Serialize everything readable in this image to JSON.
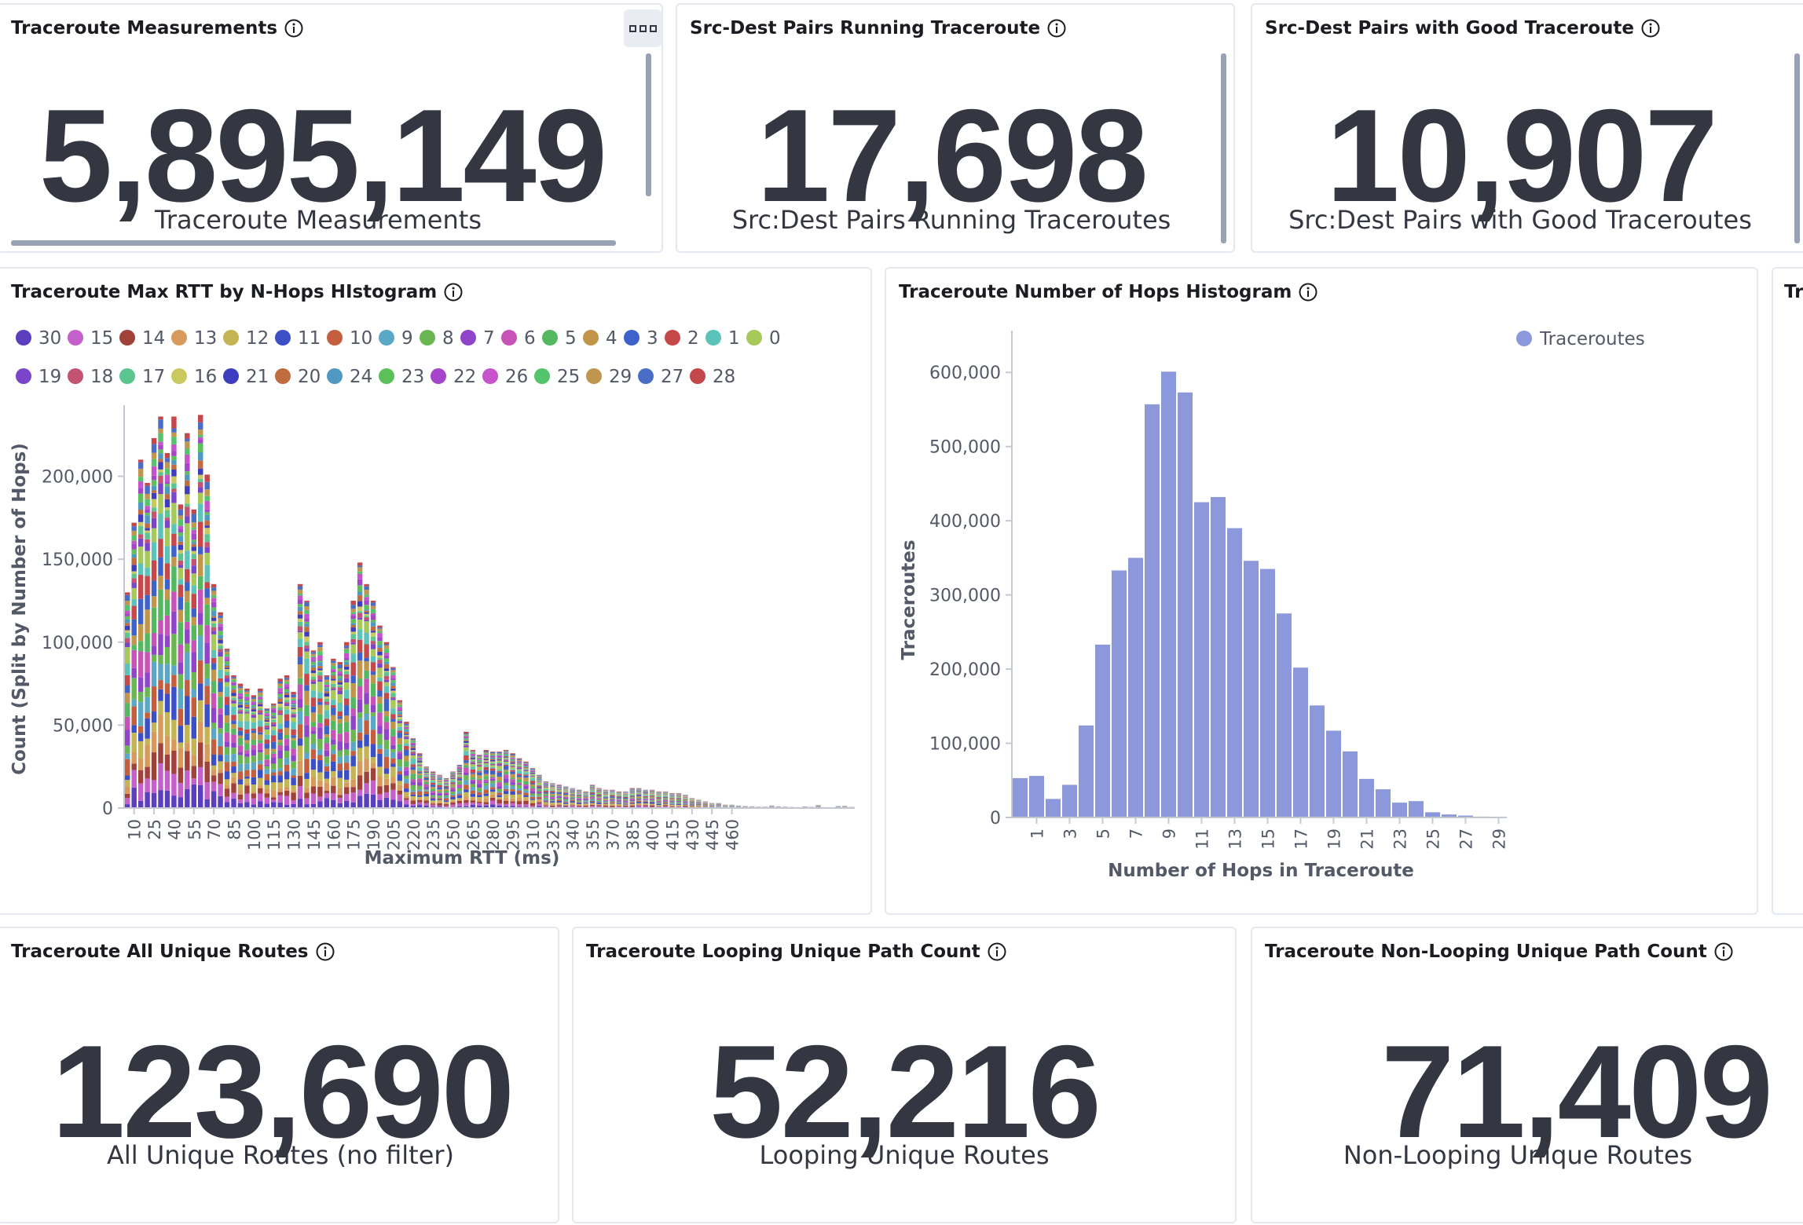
{
  "metric_panels": {
    "traceroute_measurements": {
      "title": "Traceroute Measurements",
      "value": "5,895,149",
      "label": "Traceroute Measurements"
    },
    "pairs_running": {
      "title": "Src-Dest Pairs Running Traceroute",
      "value": "17,698",
      "label": "Src:Dest Pairs Running Traceroutes"
    },
    "pairs_good": {
      "title": "Src-Dest Pairs with Good Traceroute",
      "value": "10,907",
      "label": "Src:Dest Pairs with Good Traceroutes"
    },
    "all_unique": {
      "title": "Traceroute All Unique Routes",
      "value": "123,690",
      "label": "All Unique Routes (no filter)"
    },
    "looping_unique": {
      "title": "Traceroute Looping Unique Path Count",
      "value": "52,216",
      "label": "Looping Unique Routes"
    },
    "nonlooping_unique": {
      "title": "Traceroute Non-Looping Unique Path Count",
      "value": "71,409",
      "label": "Non-Looping Unique Routes"
    }
  },
  "partial_panel": {
    "title": "Tr"
  },
  "icons": {
    "info": "info-circle-icon",
    "menu": "panel-options-icon",
    "legend_dot": "legend-dot-icon"
  },
  "chart_data": [
    {
      "type": "bar",
      "stacked": true,
      "title": "Traceroute Max RTT by N-Hops HIstogram",
      "xlabel": "Maximum RTT (ms)",
      "ylabel": "Count (Split by Number of Hops)",
      "ylim": [
        0,
        240000
      ],
      "yticks": [
        0,
        50000,
        100000,
        150000,
        200000
      ],
      "ytick_labels": [
        "0",
        "50,000",
        "100,000",
        "150,000",
        "200,000"
      ],
      "xtick_labels": [
        "10",
        "25",
        "40",
        "55",
        "70",
        "85",
        "100",
        "115",
        "130",
        "145",
        "160",
        "175",
        "190",
        "205",
        "220",
        "235",
        "250",
        "265",
        "280",
        "295",
        "310",
        "325",
        "340",
        "355",
        "370",
        "385",
        "400",
        "415",
        "430",
        "445",
        "460"
      ],
      "bin_width_ms": 5,
      "x_start_ms": 5,
      "legend_position": "top-left",
      "legend": [
        {
          "name": "30",
          "color": "#5c3fbf"
        },
        {
          "name": "15",
          "color": "#c460c9"
        },
        {
          "name": "14",
          "color": "#a0413a"
        },
        {
          "name": "13",
          "color": "#d69b5c"
        },
        {
          "name": "12",
          "color": "#c4b454"
        },
        {
          "name": "11",
          "color": "#3b4fc6"
        },
        {
          "name": "10",
          "color": "#c45e3e"
        },
        {
          "name": "9",
          "color": "#5ba7c6"
        },
        {
          "name": "8",
          "color": "#6ab752"
        },
        {
          "name": "7",
          "color": "#8f44c9"
        },
        {
          "name": "6",
          "color": "#c752b8"
        },
        {
          "name": "5",
          "color": "#54b861"
        },
        {
          "name": "4",
          "color": "#c2964a"
        },
        {
          "name": "3",
          "color": "#3d62c9"
        },
        {
          "name": "2",
          "color": "#c64848"
        },
        {
          "name": "1",
          "color": "#5bc3b9"
        },
        {
          "name": "0",
          "color": "#a6c95a"
        },
        {
          "name": "19",
          "color": "#7b45c9"
        },
        {
          "name": "18",
          "color": "#c45372"
        },
        {
          "name": "17",
          "color": "#5bc58f"
        },
        {
          "name": "16",
          "color": "#c9c95f"
        },
        {
          "name": "21",
          "color": "#3c3dbf"
        },
        {
          "name": "20",
          "color": "#c06c3e"
        },
        {
          "name": "24",
          "color": "#4f98c2"
        },
        {
          "name": "23",
          "color": "#5cc05a"
        },
        {
          "name": "22",
          "color": "#a645c9"
        },
        {
          "name": "26",
          "color": "#c653c9"
        },
        {
          "name": "25",
          "color": "#54c46c"
        },
        {
          "name": "29",
          "color": "#c0964e"
        },
        {
          "name": "27",
          "color": "#4a6ec6"
        },
        {
          "name": "28",
          "color": "#c4474c"
        }
      ],
      "totals": [
        130000,
        172000,
        210000,
        196000,
        223000,
        236000,
        214000,
        236000,
        183000,
        226000,
        180000,
        237000,
        201000,
        135000,
        118000,
        96000,
        80000,
        75000,
        72000,
        68000,
        72000,
        60000,
        63000,
        78000,
        80000,
        70000,
        135000,
        125000,
        95000,
        100000,
        80000,
        90000,
        88000,
        100000,
        125000,
        148000,
        135000,
        125000,
        110000,
        100000,
        85000,
        65000,
        52000,
        42000,
        33000,
        25000,
        22000,
        20000,
        18000,
        22000,
        26000,
        46000,
        35000,
        32000,
        35000,
        34000,
        34000,
        35000,
        33000,
        30000,
        28000,
        24000,
        20000,
        16000,
        15000,
        14000,
        13000,
        12000,
        11000,
        10000,
        14000,
        12000,
        11000,
        11000,
        10000,
        10000,
        12000,
        12000,
        11000,
        11000,
        10000,
        10000,
        9000,
        9000,
        8000,
        6000,
        5000,
        4000,
        3000,
        3000,
        2000,
        2000,
        1500,
        1200,
        1000,
        800,
        800,
        1500,
        1000,
        800,
        600,
        500,
        900,
        700,
        1800,
        500,
        400,
        1200,
        1300,
        700
      ]
    },
    {
      "type": "bar",
      "title": "Traceroute Number of Hops Histogram",
      "xlabel": "Number of Hops in Traceroute",
      "ylabel": "Traceroutes",
      "ylim": [
        0,
        650000
      ],
      "yticks": [
        0,
        100000,
        200000,
        300000,
        400000,
        500000,
        600000
      ],
      "ytick_labels": [
        "0",
        "100,000",
        "200,000",
        "300,000",
        "400,000",
        "500,000",
        "600,000"
      ],
      "xtick_labels": [
        "1",
        "3",
        "5",
        "7",
        "9",
        "11",
        "13",
        "15",
        "17",
        "19",
        "21",
        "23",
        "25",
        "27",
        "29"
      ],
      "legend_position": "top-right",
      "series": [
        {
          "name": "Traceroutes",
          "color": "#8b99dc",
          "x": [
            0,
            1,
            2,
            3,
            4,
            5,
            6,
            7,
            8,
            9,
            10,
            11,
            12,
            13,
            14,
            15,
            16,
            17,
            18,
            19,
            20,
            21,
            22,
            23,
            24,
            25,
            26,
            27,
            28,
            29
          ],
          "values": [
            53000,
            56000,
            25000,
            44000,
            124000,
            233000,
            333000,
            350000,
            557000,
            601000,
            573000,
            425000,
            432000,
            390000,
            346000,
            335000,
            275000,
            202000,
            151000,
            117000,
            89000,
            52000,
            38000,
            20000,
            22000,
            7000,
            4000,
            2500,
            1200,
            500
          ]
        }
      ]
    }
  ]
}
